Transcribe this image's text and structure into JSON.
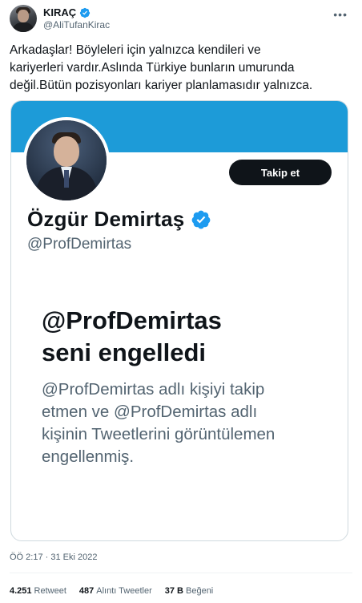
{
  "author": {
    "display_name": "KIRAÇ",
    "handle": "@AliTufanKirac",
    "more_icon": "more-horizontal-icon"
  },
  "tweet": {
    "text": "Arkadaşlar! Böyleleri için yalnızca kendileri ve\nkariyerleri vardır.Aslında Türkiye bunların umurunda\ndeğil.Bütün pozisyonları kariyer planlamasıdır yalnızca."
  },
  "card": {
    "banner_color": "#1d9bd8",
    "follow_label": "Takip et",
    "name": "Özgür Demirtaş",
    "handle": "@ProfDemirtas",
    "blocked_title_line1": "@ProfDemirtas",
    "blocked_title_line2": "seni engelledi",
    "blocked_desc_line1": "@ProfDemirtas adlı kişiyi takip",
    "blocked_desc_line2": "etmen ve @ProfDemirtas adlı",
    "blocked_desc_line3": "kişinin Tweetlerini görüntülemen",
    "blocked_desc_line4": "engellenmiş."
  },
  "meta": {
    "timestamp": "ÖÖ 2:17 · 31 Eki 2022"
  },
  "stats": {
    "retweet_count": "4.251",
    "retweet_label": "Retweet",
    "quote_count": "487",
    "quote_label": "Alıntı Tweetler",
    "like_count": "37 B",
    "like_label": "Beğeni"
  },
  "colors": {
    "verified": "#1d9bf0",
    "text": "#0f1419",
    "secondary": "#536471"
  }
}
